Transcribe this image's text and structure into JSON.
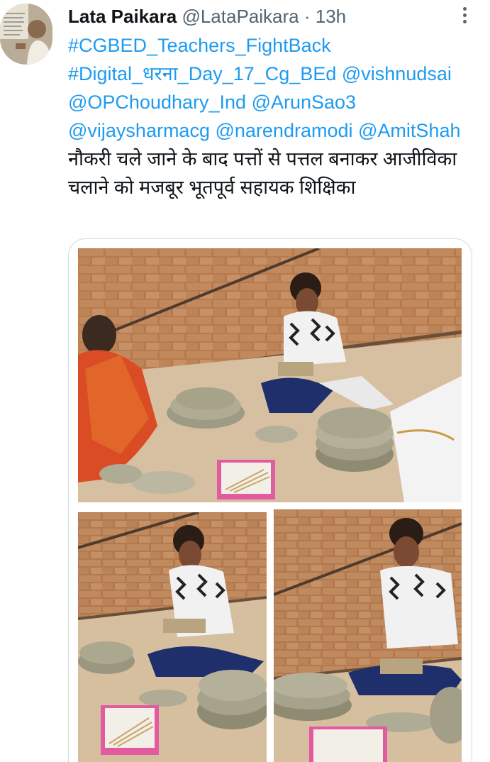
{
  "tweet": {
    "author_name": "Lata Paikara",
    "author_handle": "@LataPaikara",
    "separator": "·",
    "timestamp": "13h",
    "more_icon": "more-options-icon",
    "text_parts": [
      {
        "text": "#CGBED_Teachers_FightBack",
        "link": true
      },
      {
        "text": " ",
        "link": false
      },
      {
        "text": "#Digital_धरना_Day_17_Cg_BEd",
        "link": true
      },
      {
        "text": " ",
        "link": false
      },
      {
        "text": "@vishnudsai",
        "link": true
      },
      {
        "text": " ",
        "link": false
      },
      {
        "text": "@OPChoudhary_Ind",
        "link": true
      },
      {
        "text": " ",
        "link": false
      },
      {
        "text": "@ArunSao3",
        "link": true
      },
      {
        "text": " ",
        "link": false
      },
      {
        "text": "@vijaysharmacg",
        "link": true
      },
      {
        "text": " ",
        "link": false
      },
      {
        "text": "@narendramodi",
        "link": true
      },
      {
        "text": " ",
        "link": false
      },
      {
        "text": "@AmitShah",
        "link": true
      },
      {
        "text": " नौकरी चले जाने के बाद पत्तों से पत्तल बनाकर आजीविका चलाने को मजबूर भूतपूर्व सहायक शिक्षिका",
        "link": false
      }
    ]
  },
  "media": {
    "photos": [
      {
        "name": "photo-women-making-leaf-plates"
      },
      {
        "name": "photo-woman-stitching-leaves"
      },
      {
        "name": "photo-woman-with-leaf-plates"
      }
    ]
  }
}
